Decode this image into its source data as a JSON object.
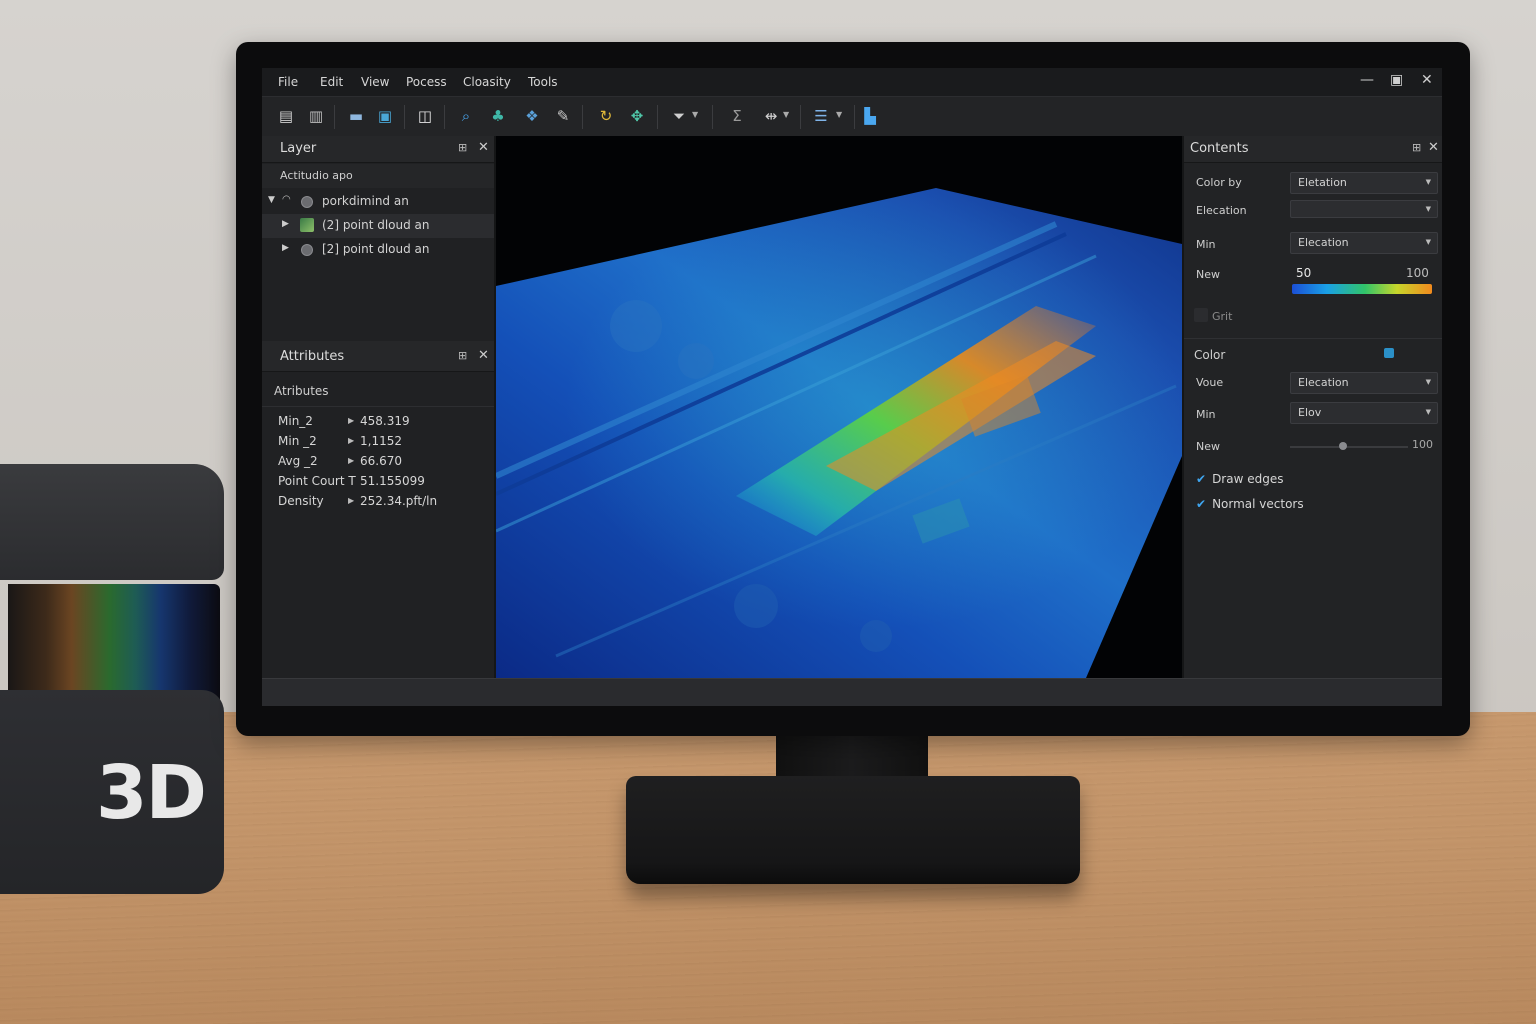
{
  "menu": [
    "File",
    "Edit",
    "View",
    "Pocess",
    "Cloasity",
    "Tools"
  ],
  "window_controls": {
    "minimize": "—",
    "maximize": "▣",
    "close": "✕"
  },
  "layer_panel": {
    "title": "Layer",
    "subtitle": "Actitudio apo",
    "items": [
      {
        "label": "porkdimind an",
        "expanded": true
      },
      {
        "label": "(2] point dloud an",
        "selected": true
      },
      {
        "label": "[2] point dloud an"
      }
    ]
  },
  "attributes_panel": {
    "title": "Attributes",
    "subtitle": "Atributes",
    "rows": [
      {
        "key": "Min_2",
        "value": "458.319"
      },
      {
        "key": "Min _2",
        "value": "1,1152"
      },
      {
        "key": "Avg _2",
        "value": "66.670"
      },
      {
        "key": "Point Court T",
        "value": "51.155099"
      },
      {
        "key": "Density",
        "value": "252.34.pft/ln"
      }
    ]
  },
  "contents_panel": {
    "title": "Contents",
    "color_by_label": "Color by",
    "color_by_value": "Eletation",
    "elecation_label": "Elecation",
    "elecation_value": "",
    "min_label": "Min",
    "min_value": "Elecation",
    "new_label": "New",
    "range_min": "50",
    "range_max": "100",
    "grit_label": "Grit",
    "color_label": "Color",
    "voue_label": "Voue",
    "voue_value": "Elecation",
    "min2_label": "Min",
    "min2_value": "Elov",
    "new2_label": "New",
    "new2_value": "100",
    "new2_slider_fraction": 0.45,
    "draw_edges": "Draw edges",
    "normal_vectors": "Normal vectors"
  },
  "device_label": "3D",
  "colors": {
    "accent": "#3fa6f0",
    "ramp": [
      "#1b4fd6",
      "#1aa0e6",
      "#31c46a",
      "#c7d62b",
      "#f28a1e"
    ]
  }
}
